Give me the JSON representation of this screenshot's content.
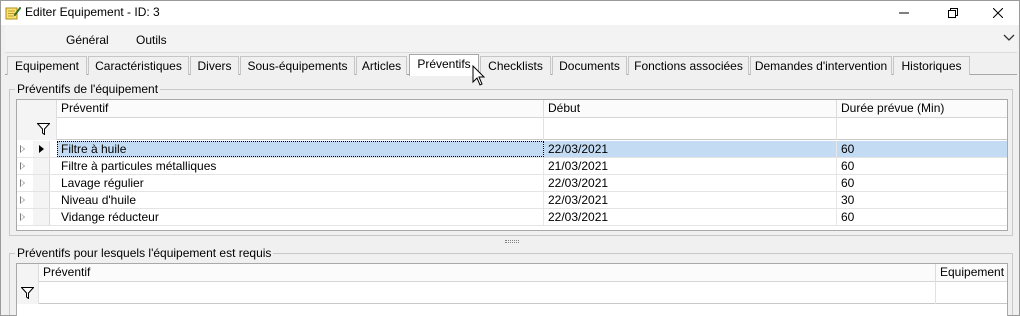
{
  "window": {
    "title": "Editer Equipement - ID: 3",
    "controls": [
      "minimize-icon",
      "restore-icon",
      "close-icon"
    ]
  },
  "menu": {
    "items": [
      "Général",
      "Outils"
    ]
  },
  "tabs": [
    {
      "label": "Equipement",
      "active": false
    },
    {
      "label": "Caractéristiques",
      "active": false
    },
    {
      "label": "Divers",
      "active": false
    },
    {
      "label": "Sous-équipements",
      "active": false
    },
    {
      "label": "Articles",
      "active": false
    },
    {
      "label": "Préventifs",
      "active": true
    },
    {
      "label": "Checklists",
      "active": false
    },
    {
      "label": "Documents",
      "active": false
    },
    {
      "label": "Fonctions associées",
      "active": false
    },
    {
      "label": "Demandes d'intervention",
      "active": false
    },
    {
      "label": "Historiques",
      "active": false
    }
  ],
  "group1": {
    "label": "Préventifs de l'équipement",
    "columns": [
      "Préventif",
      "Début",
      "Durée prévue (Min)"
    ],
    "rows": [
      {
        "preventif": "Filtre à huile",
        "debut": "22/03/2021",
        "duree": "60",
        "selected": true
      },
      {
        "preventif": "Filtre à particules métalliques",
        "debut": "21/03/2021",
        "duree": "60",
        "selected": false
      },
      {
        "preventif": "Lavage régulier",
        "debut": "22/03/2021",
        "duree": "60",
        "selected": false
      },
      {
        "preventif": "Niveau d'huile",
        "debut": "22/03/2021",
        "duree": "30",
        "selected": false
      },
      {
        "preventif": "Vidange réducteur",
        "debut": "22/03/2021",
        "duree": "60",
        "selected": false
      }
    ]
  },
  "group2": {
    "label": "Préventifs pour lesquels l'équipement est requis",
    "columns": [
      "Préventif",
      "Equipement"
    ]
  },
  "colors": {
    "selection": "#c4dcf3",
    "window_bg": "#f0f0f0"
  }
}
